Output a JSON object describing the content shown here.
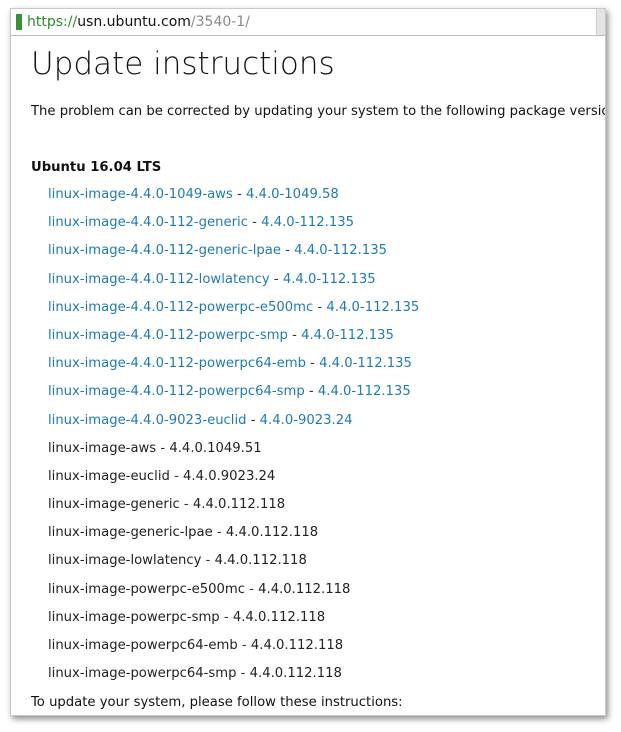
{
  "browser": {
    "url_scheme": "https://",
    "url_host": "usn.ubuntu.com",
    "url_path": "/3540-1/"
  },
  "page": {
    "title": "Update instructions",
    "intro": "The problem can be corrected by updating your system to the following package versions:",
    "release": "Ubuntu 16.04 LTS",
    "separator": " - ",
    "packages": [
      {
        "name": "linux-image-4.4.0-1049-aws",
        "version": "4.4.0-1049.58",
        "linked": true
      },
      {
        "name": "linux-image-4.4.0-112-generic",
        "version": "4.4.0-112.135",
        "linked": true
      },
      {
        "name": "linux-image-4.4.0-112-generic-lpae",
        "version": "4.4.0-112.135",
        "linked": true
      },
      {
        "name": "linux-image-4.4.0-112-lowlatency",
        "version": "4.4.0-112.135",
        "linked": true
      },
      {
        "name": "linux-image-4.4.0-112-powerpc-e500mc",
        "version": "4.4.0-112.135",
        "linked": true
      },
      {
        "name": "linux-image-4.4.0-112-powerpc-smp",
        "version": "4.4.0-112.135",
        "linked": true
      },
      {
        "name": "linux-image-4.4.0-112-powerpc64-emb",
        "version": "4.4.0-112.135",
        "linked": true
      },
      {
        "name": "linux-image-4.4.0-112-powerpc64-smp",
        "version": "4.4.0-112.135",
        "linked": true
      },
      {
        "name": "linux-image-4.4.0-9023-euclid",
        "version": "4.4.0-9023.24",
        "linked": true
      },
      {
        "name": "linux-image-aws",
        "version": "4.4.0.1049.51",
        "linked": false
      },
      {
        "name": "linux-image-euclid",
        "version": "4.4.0.9023.24",
        "linked": false
      },
      {
        "name": "linux-image-generic",
        "version": "4.4.0.112.118",
        "linked": false
      },
      {
        "name": "linux-image-generic-lpae",
        "version": "4.4.0.112.118",
        "linked": false
      },
      {
        "name": "linux-image-lowlatency",
        "version": "4.4.0.112.118",
        "linked": false
      },
      {
        "name": "linux-image-powerpc-e500mc",
        "version": "4.4.0.112.118",
        "linked": false
      },
      {
        "name": "linux-image-powerpc-smp",
        "version": "4.4.0.112.118",
        "linked": false
      },
      {
        "name": "linux-image-powerpc64-emb",
        "version": "4.4.0.112.118",
        "linked": false
      },
      {
        "name": "linux-image-powerpc64-smp",
        "version": "4.4.0.112.118",
        "linked": false
      }
    ],
    "outro": "To update your system, please follow these instructions:"
  },
  "colors": {
    "link": "#1f7ab4",
    "secure_scheme": "#2e8b2e",
    "url_path": "#8a8a8a",
    "text": "#111111"
  }
}
